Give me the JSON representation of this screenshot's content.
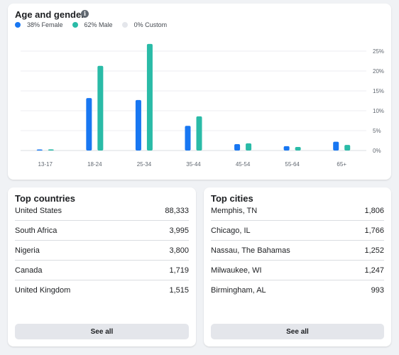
{
  "age_gender": {
    "title": "Age and gender",
    "info_icon": "info-icon",
    "legend": [
      {
        "label": "38% Female",
        "color": "#1877f2"
      },
      {
        "label": "62% Male",
        "color": "#2abba7"
      },
      {
        "label": "0% Custom",
        "color": "#e4e6eb"
      }
    ]
  },
  "chart_data": {
    "type": "bar",
    "categories": [
      "13-17",
      "18-24",
      "25-34",
      "35-44",
      "45-54",
      "55-64",
      "65+"
    ],
    "series": [
      {
        "name": "38% Female",
        "color": "#1877f2",
        "values": [
          0.2,
          13.2,
          12.7,
          6.2,
          1.6,
          1.1,
          2.2
        ]
      },
      {
        "name": "62% Male",
        "color": "#2abba7",
        "values": [
          0.3,
          21.3,
          26.8,
          8.6,
          1.8,
          0.9,
          1.4
        ]
      }
    ],
    "y_ticks": [
      "25%",
      "20%",
      "15%",
      "10%",
      "5%",
      "0%"
    ],
    "y_tick_values": [
      25,
      20,
      15,
      10,
      5,
      0
    ],
    "ylim": [
      0,
      25
    ],
    "y_axis_position": "right",
    "grid": true,
    "legend_position": "top-left",
    "title": "Age and gender",
    "xlabel": "",
    "ylabel": ""
  },
  "countries": {
    "title": "Top countries",
    "items": [
      {
        "name": "United States",
        "value": "88,333"
      },
      {
        "name": "South Africa",
        "value": "3,995"
      },
      {
        "name": "Nigeria",
        "value": "3,800"
      },
      {
        "name": "Canada",
        "value": "1,719"
      },
      {
        "name": "United Kingdom",
        "value": "1,515"
      }
    ],
    "see_all": "See all"
  },
  "cities": {
    "title": "Top cities",
    "items": [
      {
        "name": "Memphis, TN",
        "value": "1,806"
      },
      {
        "name": "Chicago, IL",
        "value": "1,766"
      },
      {
        "name": "Nassau, The Bahamas",
        "value": "1,252"
      },
      {
        "name": "Milwaukee, WI",
        "value": "1,247"
      },
      {
        "name": "Birmingham, AL",
        "value": "993"
      }
    ],
    "see_all": "See all"
  }
}
